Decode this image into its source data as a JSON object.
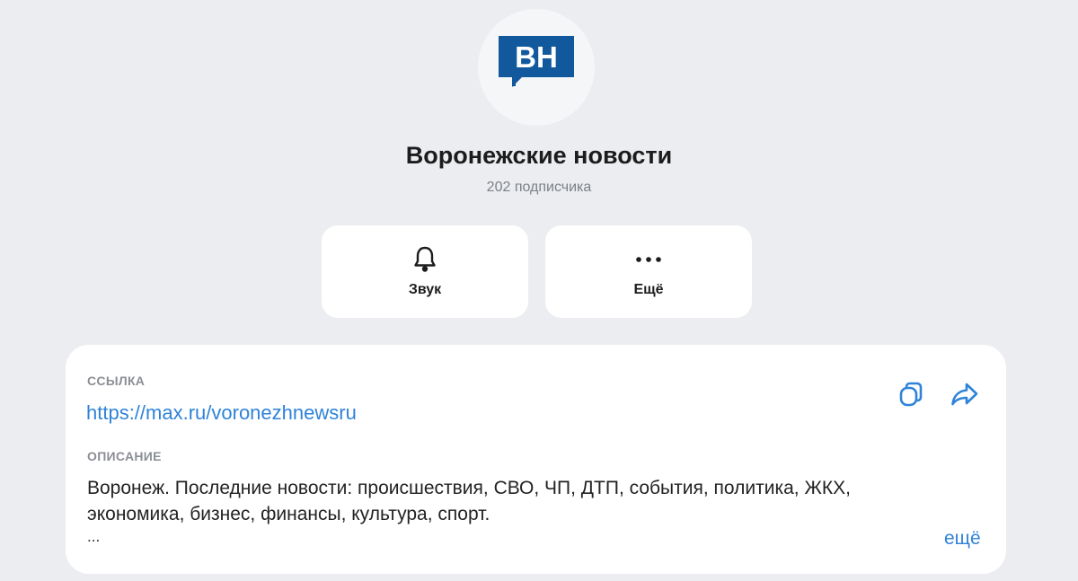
{
  "channel": {
    "logo_text": "BH",
    "title": "Воронежские новости",
    "subscribers": "202 подписчика"
  },
  "actions": {
    "sound_label": "Звук",
    "more_label": "Ещё"
  },
  "info": {
    "link_label": "ССЫЛКА",
    "link_value": "https://max.ru/voronezhnewsru",
    "description_label": "ОПИСАНИЕ",
    "description_line1": "Воронеж. Последние новости: происшествия, СВО, ЧП, ДТП, события, политика, ЖКХ,",
    "description_line2": "экономика, бизнес, финансы, культура, спорт.",
    "description_line3": "...",
    "expand_label": "ещё"
  },
  "icons": {
    "sound": "bell-icon",
    "more": "more-dots-icon",
    "copy": "copy-icon",
    "share": "share-icon"
  },
  "colors": {
    "background": "#ebedf0",
    "card": "#ffffff",
    "logo": "#12589d",
    "accent": "#2f83d8",
    "muted": "#8b8e94"
  }
}
